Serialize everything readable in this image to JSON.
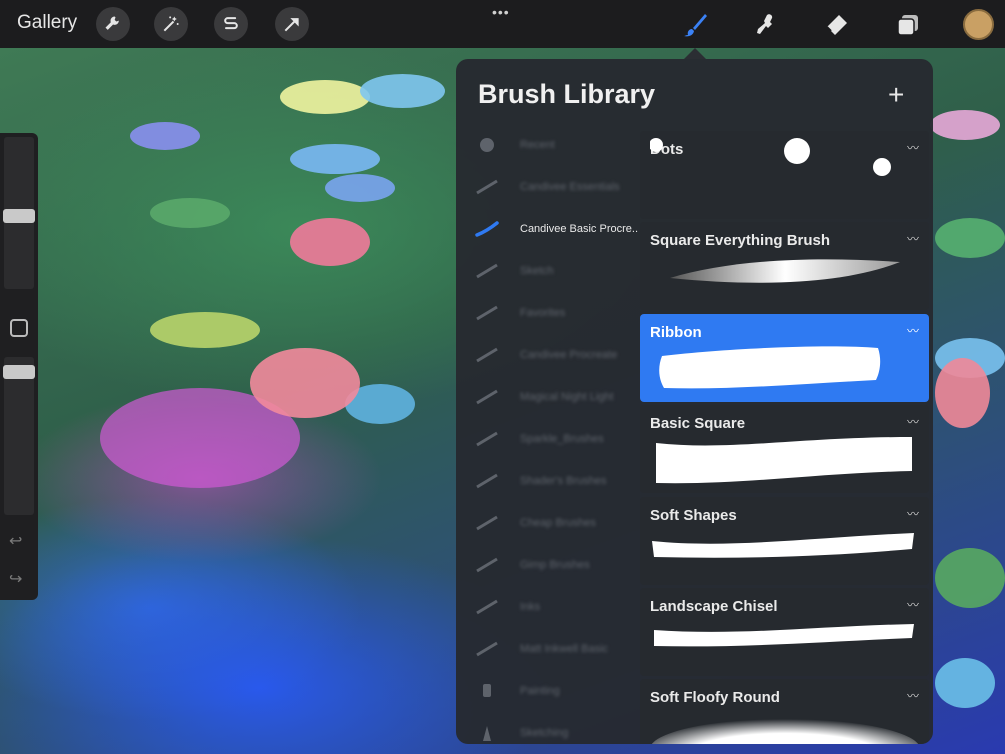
{
  "topbar": {
    "gallery_label": "Gallery",
    "tools": [
      "wrench-icon",
      "magic-wand-icon",
      "selection-icon",
      "transform-icon"
    ],
    "right_tools": [
      "brush-icon",
      "smudge-icon",
      "eraser-icon",
      "layers-icon"
    ],
    "color_hex": "#c9a064"
  },
  "panel": {
    "title": "Brush Library",
    "add_label": "+",
    "categories": [
      {
        "label": "Recent",
        "active": false
      },
      {
        "label": "Candivee Essentials",
        "active": false
      },
      {
        "label": "Candivee Basic Procre...",
        "active": true
      },
      {
        "label": "Sketch",
        "active": false
      },
      {
        "label": "Favorites",
        "active": false
      },
      {
        "label": "Candivee Procreate",
        "active": false
      },
      {
        "label": "Magical Night Light",
        "active": false
      },
      {
        "label": "Sparkle_Brushes",
        "active": false
      },
      {
        "label": "Shader's Brushes",
        "active": false
      },
      {
        "label": "Cheap Brushes",
        "active": false
      },
      {
        "label": "Gimp Brushes",
        "active": false
      },
      {
        "label": "Inks",
        "active": false
      },
      {
        "label": "Matt Inkwell Basic",
        "active": false
      },
      {
        "label": "Painting",
        "active": false
      },
      {
        "label": "Sketching",
        "active": false
      }
    ],
    "brushes": [
      {
        "name": "Dots",
        "selected": false
      },
      {
        "name": "Square Everything Brush",
        "selected": false
      },
      {
        "name": "Ribbon",
        "selected": true
      },
      {
        "name": "Basic Square",
        "selected": false
      },
      {
        "name": "Soft Shapes",
        "selected": false
      },
      {
        "name": "Landscape Chisel",
        "selected": false
      },
      {
        "name": "Soft Floofy Round",
        "selected": false
      }
    ]
  },
  "colors": {
    "accent": "#2f7af2",
    "panel_bg": "#262a2f",
    "topbar_bg": "#1c1c1e"
  }
}
